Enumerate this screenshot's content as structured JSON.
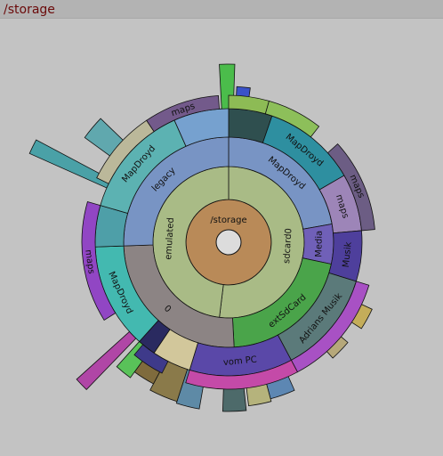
{
  "title": "/storage",
  "root": {
    "label": "/storage",
    "color": "#b98a58"
  },
  "rings": [
    [
      {
        "label": "sdcard0",
        "a0": -90,
        "a1": 97,
        "color": "#a9bb86"
      },
      {
        "label": "emulated",
        "a0": 97,
        "a1": 270,
        "color": "#a9bb86"
      }
    ],
    [
      {
        "label": "MapDroyd",
        "a0": -90,
        "a1": -10,
        "color": "#7894c4"
      },
      {
        "label": "Media",
        "a0": -10,
        "a1": 12,
        "color": "#7060b8"
      },
      {
        "label": "extSdCard",
        "a0": 12,
        "a1": 87,
        "color": "#4aa44a"
      },
      {
        "label": "0",
        "a0": 87,
        "a1": 178,
        "color": "#8c8484"
      },
      {
        "label": "legacy",
        "a0": 178,
        "a1": 270,
        "color": "#7894c4"
      }
    ],
    [
      {
        "label": "",
        "a0": -90,
        "a1": -71,
        "color": "#2f4f4f"
      },
      {
        "label": "MapDroyd",
        "a0": -71,
        "a1": -30,
        "color": "#2e8fa0"
      },
      {
        "label": "maps",
        "a0": -30,
        "a1": -5,
        "color": "#9d85b8"
      },
      {
        "label": "Musik",
        "a0": -5,
        "a1": 17,
        "color": "#4e3f9c"
      },
      {
        "label": "Adrians Musik",
        "a0": 17,
        "a1": 62,
        "color": "#5b7a7a"
      },
      {
        "label": "vom PC",
        "a0": 62,
        "a1": 107,
        "color": "#5a48a8"
      },
      {
        "label": "",
        "a0": 107,
        "a1": 124,
        "color": "#d2c79b"
      },
      {
        "label": "",
        "a0": 124,
        "a1": 132,
        "color": "#2a2a60"
      },
      {
        "label": "MapDroyd",
        "a0": 132,
        "a1": 178,
        "color": "#43b9b0"
      },
      {
        "label": "",
        "a0": 178,
        "a1": 196,
        "color": "#4e9fa8"
      },
      {
        "label": "MapDroyd",
        "a0": 196,
        "a1": 246,
        "color": "#5cb2b2"
      },
      {
        "label": "",
        "a0": 246,
        "a1": 270,
        "color": "#76a1cf"
      }
    ],
    [
      {
        "label": "",
        "a0": -90,
        "a1": -74,
        "color": "#8dbb55"
      },
      {
        "label": "",
        "a0": -74,
        "a1": -52,
        "color": "#8dbf5a"
      },
      {
        "label": "maps",
        "a0": -42,
        "a1": -5,
        "color": "#6c5d84"
      },
      {
        "label": "",
        "a0": 17,
        "a1": 62,
        "color": "#a851c4"
      },
      {
        "label": "",
        "a0": 62,
        "a1": 107,
        "color": "#c44aa8"
      },
      {
        "label": "",
        "a0": 117,
        "a1": 130,
        "color": "#3e3a8a"
      },
      {
        "label": "maps",
        "a0": 148,
        "a1": 196,
        "color": "#9146c4"
      },
      {
        "label": "",
        "a0": 206,
        "a1": 236,
        "color": "#bbb89a"
      },
      {
        "label": "maps",
        "a0": 236,
        "a1": 266,
        "color": "#735a8b"
      }
    ]
  ],
  "outer_blocks": [
    {
      "r0": 150,
      "r1": 178,
      "a0": 25,
      "a1": 33,
      "color": "#c4ad5a"
    },
    {
      "r0": 150,
      "r1": 175,
      "a0": 40,
      "a1": 48,
      "color": "#b6a87a"
    },
    {
      "r0": 150,
      "r1": 182,
      "a0": 66,
      "a1": 75,
      "color": "#5d87b3"
    },
    {
      "r0": 150,
      "r1": 185,
      "a0": 75,
      "a1": 83,
      "color": "#b5b37c"
    },
    {
      "r0": 150,
      "r1": 190,
      "a0": 84,
      "a1": 92,
      "color": "#4d6a6a"
    },
    {
      "r0": 150,
      "r1": 190,
      "a0": 100,
      "a1": 108,
      "color": "#5e8aa6"
    },
    {
      "r0": 150,
      "r1": 188,
      "a0": 108,
      "a1": 118,
      "color": "#8a7a4a"
    },
    {
      "r0": 150,
      "r1": 180,
      "a0": 118,
      "a1": 126,
      "color": "#7f6b3d"
    },
    {
      "r0": 150,
      "r1": 188,
      "a0": 126,
      "a1": 132,
      "color": "#59c259"
    },
    {
      "r0": 150,
      "r1": 230,
      "a0": 134,
      "a1": 138,
      "color": "#b046a6"
    },
    {
      "r0": 150,
      "r1": 200,
      "a0": 216,
      "a1": 224,
      "color": "#60a8ae"
    },
    {
      "r0": 150,
      "r1": 245,
      "a0": 204,
      "a1": 208,
      "color": "#4aa1a7"
    },
    {
      "r0": 110,
      "r1": 200,
      "a0": -93,
      "a1": -88,
      "color": "#4bbc4b"
    },
    {
      "r0": 110,
      "r1": 175,
      "a0": -87,
      "a1": -82,
      "color": "#3a52c8"
    },
    {
      "r0": 110,
      "r1": 150,
      "a0": -98,
      "a1": -93,
      "color": "#6abb46"
    }
  ],
  "colors": {
    "background": "#c3c3c3",
    "titlebar": "#b3b3b3",
    "title_text": "#6b0a0a",
    "center_hole": "#dcdcdc"
  }
}
